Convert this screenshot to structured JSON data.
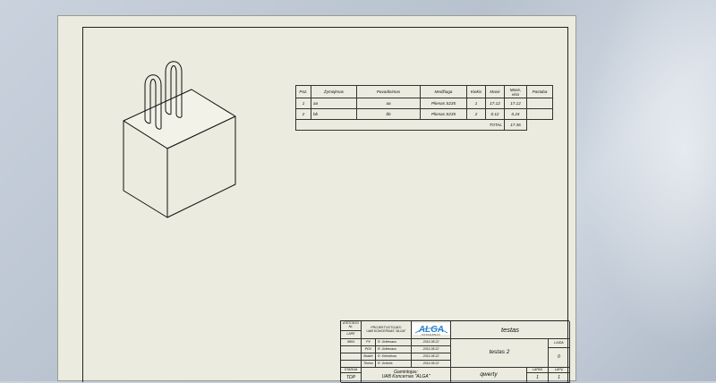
{
  "bom": {
    "headers": [
      "Poz.",
      "Žymėjimas",
      "Pavadinimas",
      "Medžiaga",
      "Kiekis",
      "Masė",
      "Masė, viso",
      "Pastaba"
    ],
    "rows": [
      [
        "1",
        "aa",
        "aa",
        "Plienas S235",
        "1",
        "17.12",
        "17.12",
        ""
      ],
      [
        "2",
        "bb",
        "bb",
        "Plienas S235",
        "2",
        "0.12",
        "0.24",
        ""
      ]
    ],
    "total_label": "TOTAL",
    "total_value": "17.36"
  },
  "title_block": {
    "stage_label_1": "ATESTATO Nr.",
    "stage_label_2": "LAPE",
    "project_label": "PROJEKTUOTOJAS:",
    "project_company": "UAB KONCERNAS \"ALGA\"",
    "logo_text": "ALGA",
    "logo_sub": "KONCERNAS",
    "name_primary": "testas",
    "name_secondary": "testas 2",
    "code": "qwerty",
    "sign_rows": [
      {
        "role": "PV",
        "name": "R. Grikenaus",
        "date": "2011.08.22"
      },
      {
        "role": "PDV",
        "name": "R. Grikenaus",
        "date": "2011.08.22"
      },
      {
        "role": "Braižė",
        "name": "R. Kelmičnas",
        "date": "2011.08.22"
      },
      {
        "role": "Tikrino",
        "name": "R. Grižulis",
        "date": "2011.08.22"
      }
    ],
    "sign_no": "9864",
    "stadija_label": "STADIJA",
    "stadija_value": "TDP",
    "manufacturer_label": "Gamintojas:",
    "manufacturer_value": "UAB Koncernas \"ALGA\"",
    "laida_label": "LAIDA",
    "laida_value": "0",
    "lapas_label": "LAPAS",
    "lapas_value": "1",
    "lapu_label": "LAPŲ",
    "lapu_value": "1"
  }
}
